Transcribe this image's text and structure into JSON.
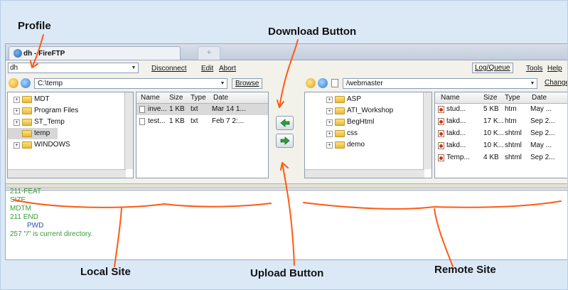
{
  "annotations": {
    "profile": "Profile",
    "download": "Download Button",
    "upload": "Upload Button",
    "local_site": "Local Site",
    "remote_site": "Remote Site"
  },
  "window": {
    "tab_title": "dh - FireFTP",
    "new_tab": "+"
  },
  "toolbar": {
    "account": "dh",
    "disconnect": "Disconnect",
    "edit": "Edit",
    "abort": "Abort",
    "log_queue": "Log/Queue",
    "tools": "Tools",
    "help": "Help"
  },
  "local": {
    "path": "C:\\temp",
    "browse": "Browse",
    "folders": [
      {
        "name": "MDT",
        "expander": "+"
      },
      {
        "name": "Program Files",
        "expander": "+"
      },
      {
        "name": "ST_Temp",
        "expander": "+"
      },
      {
        "name": "temp",
        "expander": "",
        "selected": true
      },
      {
        "name": "WINDOWS",
        "expander": "+"
      }
    ],
    "columns": [
      "Name",
      "Size",
      "Type",
      "Date"
    ],
    "files": [
      {
        "name": "inve...",
        "size": "1 KB",
        "type": "txt",
        "date": "Mar 14 1..."
      },
      {
        "name": "test...",
        "size": "1 KB",
        "type": "txt",
        "date": "Feb 7 2:..."
      }
    ]
  },
  "remote": {
    "path": "/webmaster",
    "change": "Change",
    "folders": [
      {
        "name": "ASP",
        "expander": "+"
      },
      {
        "name": "ATI_Workshop",
        "expander": "+"
      },
      {
        "name": "BegHtml",
        "expander": "+"
      },
      {
        "name": "css",
        "expander": "+"
      },
      {
        "name": "demo",
        "expander": "+"
      }
    ],
    "columns": [
      "Name",
      "Size",
      "Type",
      "Date"
    ],
    "files": [
      {
        "name": "stud...",
        "size": "5 KB",
        "type": "htm",
        "date": "May ..."
      },
      {
        "name": "takd...",
        "size": "17 K...",
        "type": "htm",
        "date": "Sep 2..."
      },
      {
        "name": "takd...",
        "size": "10 K...",
        "type": "shtml",
        "date": "Sep 2..."
      },
      {
        "name": "takd...",
        "size": "10 K...",
        "type": "shtml",
        "date": "May ..."
      },
      {
        "name": "Temp...",
        "size": "4 KB",
        "type": "shtml",
        "date": "Sep 2..."
      }
    ]
  },
  "log": [
    {
      "text": "211-FEAT",
      "color": "#3a9a3a"
    },
    {
      "text": "SIZE",
      "color": "#3a9a3a"
    },
    {
      "text": "MDTM",
      "color": "#3a9a3a"
    },
    {
      "text": "211 END",
      "color": "#3a9a3a"
    },
    {
      "text": "PWD",
      "color": "#2a4fb0",
      "indent": true
    },
    {
      "text": "257 \"/\" is current directory.",
      "color": "#3a9a3a"
    }
  ],
  "colors": {
    "annotation_line": "#ff5a14",
    "log_response": "#3a9a3a",
    "log_command": "#2a4fb0",
    "arrow_green": "#2f9e3c"
  }
}
